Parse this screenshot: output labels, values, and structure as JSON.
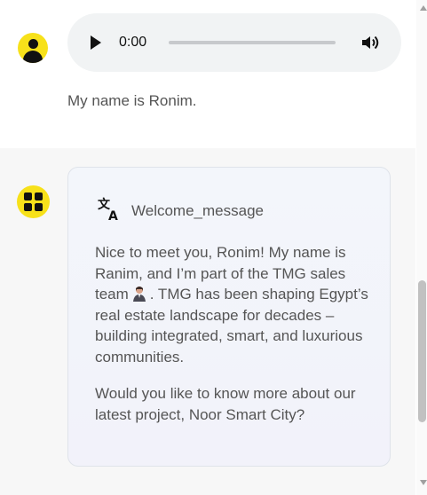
{
  "audio": {
    "time": "0:00"
  },
  "user": {
    "message": "My name is Ronim."
  },
  "bot": {
    "title": "Welcome_message",
    "p1a": "Nice to meet you, Ronim! My name is Ranim, and I’m part of the TMG sales team",
    "p1b": ". TMG has been shaping Egypt’s real estate landscape for decades – building integrated, smart, and luxurious communities.",
    "p2": "Would you like to know more about our latest project, Noor Smart City?"
  },
  "colors": {
    "avatar_bg": "#f7e11a",
    "audio_bg": "#f1f3f4",
    "card_border": "#dfe3ea"
  },
  "icons": [
    "user-avatar",
    "play-icon",
    "volume-icon",
    "bot-logo",
    "translate-icon",
    "businesswoman-emoji"
  ]
}
